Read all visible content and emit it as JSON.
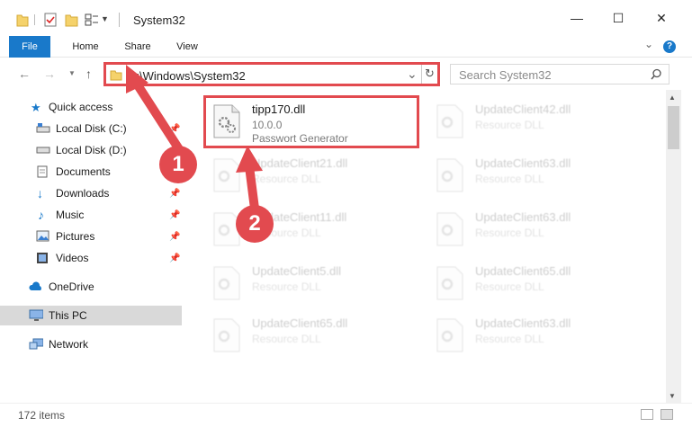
{
  "window": {
    "title": "System32",
    "minimize": "—",
    "maximize": "☐",
    "close": "✕"
  },
  "ribbon": {
    "tabs": [
      "File",
      "Home",
      "Share",
      "View"
    ],
    "expand": "⌄",
    "help": "?"
  },
  "address": {
    "path": "C:\\Windows\\System32",
    "refresh": "↻",
    "dropdown": "⌄"
  },
  "search": {
    "placeholder": "Search System32"
  },
  "sidebar": {
    "items": [
      {
        "label": "Quick access"
      },
      {
        "label": "Local Disk (C:)"
      },
      {
        "label": "Local Disk (D:)"
      },
      {
        "label": "Documents"
      },
      {
        "label": "Downloads"
      },
      {
        "label": "Music"
      },
      {
        "label": "Pictures"
      },
      {
        "label": "Videos"
      },
      {
        "label": "OneDrive"
      },
      {
        "label": "This PC"
      },
      {
        "label": "Network"
      }
    ]
  },
  "files": {
    "highlighted": {
      "name": "tipp170.dll",
      "version": "10.0.0",
      "description": "Passwort Generator"
    },
    "background": [
      {
        "name": "UpdateClient42.dll",
        "description": "Resource DLL"
      },
      {
        "name": "UpdateClient21.dll",
        "description": "Resource DLL"
      },
      {
        "name": "UpdateClient63.dll",
        "description": "Resource DLL"
      },
      {
        "name": "UpdateClient11.dll",
        "description": "Resource DLL"
      },
      {
        "name": "UpdateClient63.dll",
        "description": "Resource DLL"
      },
      {
        "name": "UpdateClient5.dll",
        "description": "Resource DLL"
      },
      {
        "name": "UpdateClient65.dll",
        "description": "Resource DLL"
      },
      {
        "name": "UpdateClient65.dll",
        "description": "Resource DLL"
      },
      {
        "name": "UpdateClient63.dll",
        "description": "Resource DLL"
      }
    ]
  },
  "status": {
    "count": "172 items"
  },
  "annotations": {
    "step1": "1",
    "step2": "2",
    "color": "#e24a4f"
  },
  "colors": {
    "accent": "#1979ca",
    "highlight": "#e24a4f",
    "selected": "#d9d9d9"
  }
}
